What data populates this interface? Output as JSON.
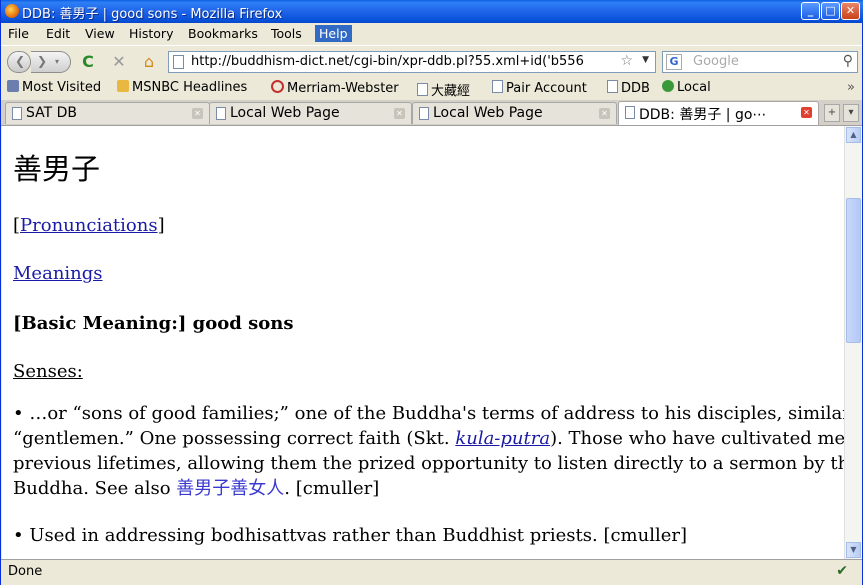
{
  "window": {
    "title": "DDB: 善男子 | good sons - Mozilla Firefox"
  },
  "menu": [
    "File",
    "Edit",
    "View",
    "History",
    "Bookmarks",
    "Tools",
    "Help"
  ],
  "nav": {
    "url": "http://buddhism-dict.net/cgi-bin/xpr-ddb.pl?55.xml+id('b556",
    "search_placeholder": "Google"
  },
  "bookmarks": [
    "Most Visited",
    "MSNBC Headlines",
    "Merriam-Webster",
    "大藏經",
    "Pair Account",
    "DDB",
    "Local"
  ],
  "tabs": [
    "SAT DB",
    "Local Web Page",
    "Local Web Page",
    "DDB: 善男子 | go⋯"
  ],
  "page": {
    "heading": "善男子",
    "pron_open": "[",
    "pron_link": "Pronunciations",
    "pron_close": "]",
    "meanings_link": "Meanings",
    "basic_meaning": "[Basic Meaning:] good sons",
    "senses_label": "Senses:",
    "sense1_a": "• …or “sons of good families;” one of the Buddha's terms of address to his disciples, similar to",
    "sense1_b_pre": "“gentlemen.” One possessing correct faith (Skt. ",
    "sense1_b_term": "kula-putra",
    "sense1_b_post": "). Those who have cultivated merit in",
    "sense1_c": "previous lifetimes, allowing them the prized opportunity to listen directly to a sermon by the",
    "sense1_d_pre": "Buddha. See also ",
    "sense1_d_link": "善男子善女人",
    "sense1_d_post": ". [cmuller]",
    "sense2": "• Used in addressing bodhisattvas rather than Buddhist priests. [cmuller]"
  },
  "status": {
    "text": "Done"
  }
}
